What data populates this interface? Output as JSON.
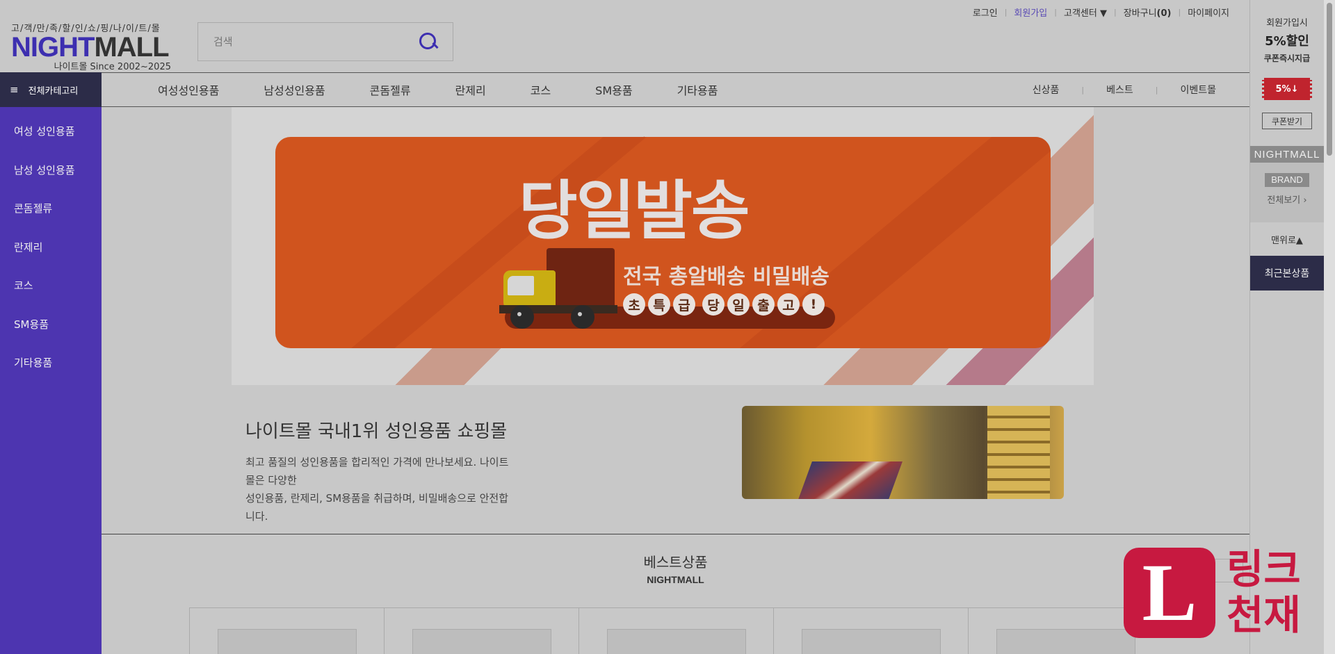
{
  "util_nav": {
    "items": [
      "로그인",
      "회원가입",
      "고객센터",
      "장바구니",
      "마이페이지"
    ],
    "cart_count": "(0)",
    "dropdown_arrow": "▼"
  },
  "logo": {
    "tagline": "고/객/만/족/할/인/쇼/핑/나/이/트/몰",
    "brand_a": "NIGHT",
    "brand_b": "MALL",
    "since": "나이트몰 Since 2002~2025"
  },
  "search": {
    "label": "검색",
    "icon": "search-icon"
  },
  "gnb": {
    "all_categories": "전체카테고리",
    "menu": [
      "여성성인용품",
      "남성성인용품",
      "콘돔젤류",
      "란제리",
      "코스",
      "SM용품",
      "기타용품"
    ],
    "right": [
      "신상품",
      "베스트",
      "이벤트몰"
    ]
  },
  "sidebar": {
    "items": [
      "여성 성인용품",
      "남성 성인용품",
      "콘돔젤류",
      "란제리",
      "코스",
      "SM용품",
      "기타용품"
    ]
  },
  "banner": {
    "headline": "당일발송",
    "subline": "전국 총알배송 비밀배송",
    "chips": [
      "초",
      "특",
      "급",
      "당",
      "일",
      "출",
      "고",
      "!"
    ]
  },
  "intro": {
    "title": "나이트몰 국내1위 성인용품 쇼핑몰",
    "desc_line1": "최고 품질의 성인용품을 합리적인 가격에 만나보세요. 나이트몰은 다양한",
    "desc_line2": "성인용품, 란제리, SM용품을 취급하며, 비밀배송으로 안전합니다."
  },
  "section": {
    "title": "베스트상품",
    "subtitle": "NIGHTMALL"
  },
  "quick": {
    "join_line1": "회원가입시",
    "join_big": "5%할인",
    "join_small": "쿠폰즉시지급",
    "coupon": "5%",
    "coupon_btn": "쿠폰받기",
    "nightmall": "NIGHTMALL",
    "brand": "BRAND",
    "view_all": "전체보기 ›",
    "top": "맨위로▲",
    "recent": "최근본상품"
  },
  "watermark": {
    "letter": "L",
    "text_line1": "링크",
    "text_line2": "천재"
  },
  "colors": {
    "accent": "#4d35b0",
    "dark": "#2c2c48",
    "banner_orange": "#d0541e",
    "watermark_red": "#c71940"
  }
}
